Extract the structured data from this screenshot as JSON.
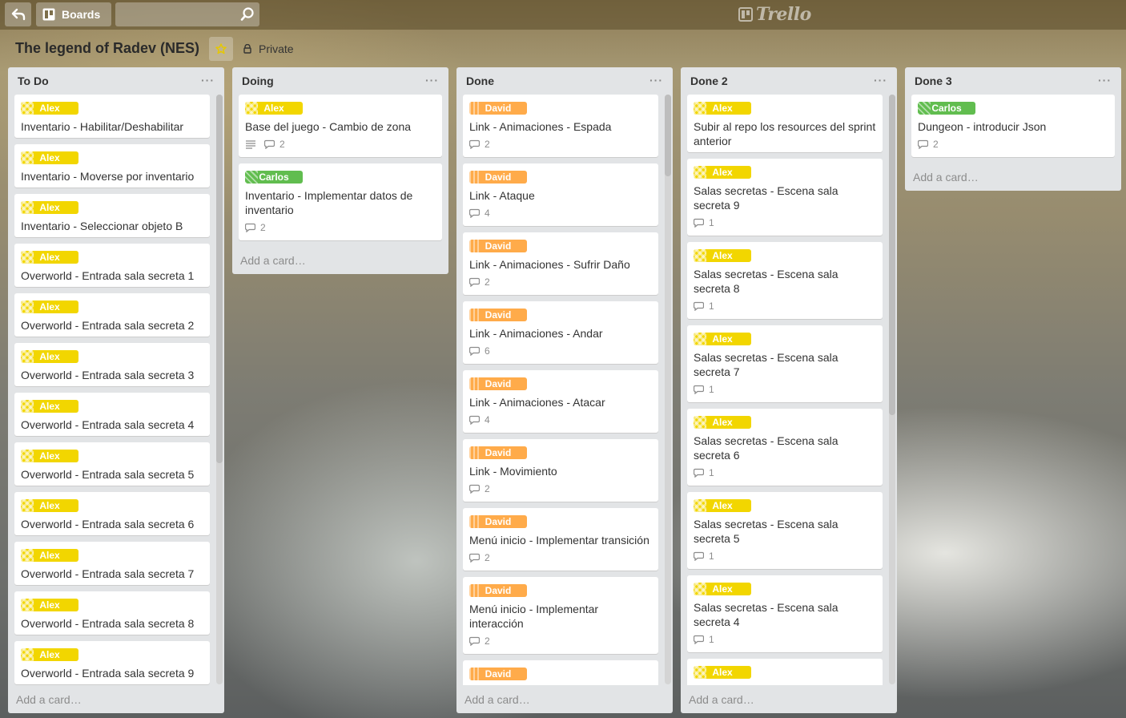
{
  "header": {
    "boards_label": "Boards",
    "search_value": "",
    "logo_text": "Trello"
  },
  "board": {
    "title": "The legend of Radev (NES)",
    "privacy": "Private"
  },
  "lists": [
    {
      "name": "To Do",
      "add_card": "Add a card…",
      "cards": [
        {
          "label": "Alex",
          "title": "Inventario - Habilitar/Deshabilitar"
        },
        {
          "label": "Alex",
          "title": "Inventario - Moverse por inventario"
        },
        {
          "label": "Alex",
          "title": "Inventario - Seleccionar objeto B"
        },
        {
          "label": "Alex",
          "title": "Overworld - Entrada sala secreta 1"
        },
        {
          "label": "Alex",
          "title": "Overworld - Entrada sala secreta 2"
        },
        {
          "label": "Alex",
          "title": "Overworld - Entrada sala secreta 3"
        },
        {
          "label": "Alex",
          "title": "Overworld - Entrada sala secreta 4"
        },
        {
          "label": "Alex",
          "title": "Overworld - Entrada sala secreta 5"
        },
        {
          "label": "Alex",
          "title": "Overworld - Entrada sala secreta 6"
        },
        {
          "label": "Alex",
          "title": "Overworld - Entrada sala secreta 7"
        },
        {
          "label": "Alex",
          "title": "Overworld - Entrada sala secreta 8"
        },
        {
          "label": "Alex",
          "title": "Overworld - Entrada sala secreta 9"
        }
      ]
    },
    {
      "name": "Doing",
      "add_card": "Add a card…",
      "cards": [
        {
          "label": "Alex",
          "title": "Base del juego - Cambio de zona",
          "description": true,
          "comments": "2"
        },
        {
          "label": "Carlos",
          "title": "Inventario - Implementar datos de inventario",
          "comments": "2"
        }
      ]
    },
    {
      "name": "Done",
      "add_card": "Add a card…",
      "cards": [
        {
          "label": "David",
          "title": "Link - Animaciones - Espada",
          "comments": "2"
        },
        {
          "label": "David",
          "title": "Link - Ataque",
          "comments": "4"
        },
        {
          "label": "David",
          "title": "Link - Animaciones - Sufrir Daño",
          "comments": "2"
        },
        {
          "label": "David",
          "title": "Link - Animaciones - Andar",
          "comments": "6"
        },
        {
          "label": "David",
          "title": "Link - Animaciones - Atacar",
          "comments": "4"
        },
        {
          "label": "David",
          "title": "Link - Movimiento",
          "comments": "2"
        },
        {
          "label": "David",
          "title": "Menú inicio - Implementar transición",
          "comments": "2"
        },
        {
          "label": "David",
          "title": "Menú inicio - Implementar interacción",
          "comments": "2"
        },
        {
          "label": "David",
          "title": ""
        }
      ]
    },
    {
      "name": "Done 2",
      "add_card": "Add a card…",
      "cards": [
        {
          "label": "Alex",
          "title": "Subir al repo los resources del sprint anterior"
        },
        {
          "label": "Alex",
          "title": "Salas secretas - Escena sala secreta 9",
          "comments": "1"
        },
        {
          "label": "Alex",
          "title": "Salas secretas - Escena sala secreta 8",
          "comments": "1"
        },
        {
          "label": "Alex",
          "title": "Salas secretas - Escena sala secreta 7",
          "comments": "1"
        },
        {
          "label": "Alex",
          "title": "Salas secretas - Escena sala secreta 6",
          "comments": "1"
        },
        {
          "label": "Alex",
          "title": "Salas secretas - Escena sala secreta 5",
          "comments": "1"
        },
        {
          "label": "Alex",
          "title": "Salas secretas - Escena sala secreta 4",
          "comments": "1"
        },
        {
          "label": "Alex",
          "title": ""
        }
      ]
    },
    {
      "name": "Done 3",
      "add_card": "Add a card…",
      "cards": [
        {
          "label": "Carlos",
          "title": "Dungeon - introducir Json",
          "comments": "2"
        }
      ]
    }
  ]
}
